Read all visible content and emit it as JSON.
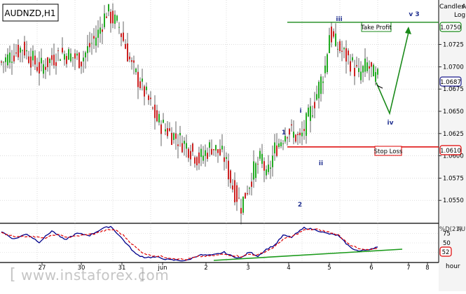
{
  "chart_data": {
    "type": "candlestick",
    "title": "AUDNZD,H1",
    "top_right": {
      "label": "Candles",
      "source": "A",
      "scale": "Log"
    },
    "osc_label": "%D(21)",
    "osc_label_suffix": "AU",
    "xlabel": "hour",
    "x_ticks": [
      "27",
      "30",
      "31",
      "jun",
      "2",
      "3",
      "4",
      "5",
      "6",
      "7",
      "8"
    ],
    "price_axis": {
      "ylim": [
        1.0525,
        1.0775
      ],
      "ticks": [
        "1.0725",
        "1.0700",
        "1.0675",
        "1.0650",
        "1.0625",
        "1.0600",
        "1.0575",
        "1.0550"
      ]
    },
    "osc_axis": {
      "ylim": [
        0,
        100
      ],
      "ticks": [
        "75",
        "50",
        "25"
      ]
    },
    "levels": {
      "take_profit": {
        "label": "Take Profit",
        "value": 1.075,
        "value_label": "1.0750",
        "color": "#1a8a1a"
      },
      "stop_loss": {
        "label": "Stop Loss",
        "value": 1.061,
        "value_label": "1.0610",
        "color": "#dd0000"
      },
      "current": {
        "value": 1.0687,
        "value_label": "1.0687",
        "color": "#1a1a8c"
      }
    },
    "osc_current": {
      "value": 52,
      "value_label": "52"
    },
    "wave_labels": [
      "1",
      "2",
      "i",
      "ii",
      "iii",
      "iv",
      "v 3"
    ],
    "wave_label_color": "#1f2f8f",
    "series": [
      {
        "name": "price",
        "anchors": [
          [
            0,
            1.0705
          ],
          [
            10,
            1.0722
          ],
          [
            18,
            1.0698
          ],
          [
            28,
            1.0716
          ],
          [
            38,
            1.0708
          ],
          [
            46,
            1.0738
          ],
          [
            50,
            1.0762
          ],
          [
            56,
            1.0745
          ],
          [
            62,
            1.07
          ],
          [
            68,
            1.0672
          ],
          [
            74,
            1.064
          ],
          [
            80,
            1.0626
          ],
          [
            88,
            1.0612
          ],
          [
            94,
            1.0596
          ],
          [
            100,
            1.0611
          ],
          [
            106,
            1.0598
          ],
          [
            110,
            1.0565
          ],
          [
            114,
            1.0544
          ],
          [
            120,
            1.0583
          ],
          [
            124,
            1.0598
          ],
          [
            126,
            1.0574
          ],
          [
            130,
            1.0607
          ],
          [
            136,
            1.063
          ],
          [
            142,
            1.0618
          ],
          [
            148,
            1.0655
          ],
          [
            154,
            1.07
          ],
          [
            156,
            1.0738
          ],
          [
            160,
            1.0722
          ],
          [
            166,
            1.0706
          ],
          [
            170,
            1.069
          ],
          [
            174,
            1.0702
          ],
          [
            178,
            1.0687
          ]
        ]
      },
      {
        "name": "%K",
        "color": "#00008b",
        "anchors": [
          [
            0,
            80
          ],
          [
            6,
            60
          ],
          [
            12,
            74
          ],
          [
            18,
            52
          ],
          [
            24,
            82
          ],
          [
            30,
            58
          ],
          [
            36,
            75
          ],
          [
            42,
            70
          ],
          [
            48,
            88
          ],
          [
            52,
            94
          ],
          [
            56,
            70
          ],
          [
            60,
            45
          ],
          [
            64,
            20
          ],
          [
            68,
            12
          ],
          [
            74,
            12
          ],
          [
            80,
            5
          ],
          [
            88,
            3
          ],
          [
            94,
            18
          ],
          [
            100,
            17
          ],
          [
            106,
            25
          ],
          [
            110,
            14
          ],
          [
            114,
            10
          ],
          [
            118,
            26
          ],
          [
            122,
            15
          ],
          [
            126,
            33
          ],
          [
            130,
            44
          ],
          [
            134,
            70
          ],
          [
            138,
            65
          ],
          [
            144,
            90
          ],
          [
            150,
            84
          ],
          [
            154,
            76
          ],
          [
            160,
            70
          ],
          [
            166,
            38
          ],
          [
            170,
            28
          ],
          [
            174,
            32
          ],
          [
            178,
            38
          ]
        ]
      },
      {
        "name": "%D",
        "color": "#dd0000",
        "anchors": [
          [
            0,
            76
          ],
          [
            8,
            66
          ],
          [
            14,
            68
          ],
          [
            20,
            62
          ],
          [
            26,
            72
          ],
          [
            32,
            65
          ],
          [
            38,
            70
          ],
          [
            44,
            74
          ],
          [
            50,
            84
          ],
          [
            54,
            85
          ],
          [
            58,
            70
          ],
          [
            62,
            48
          ],
          [
            66,
            28
          ],
          [
            70,
            18
          ],
          [
            76,
            14
          ],
          [
            82,
            9
          ],
          [
            88,
            6
          ],
          [
            94,
            14
          ],
          [
            100,
            16
          ],
          [
            106,
            20
          ],
          [
            110,
            17
          ],
          [
            114,
            14
          ],
          [
            118,
            20
          ],
          [
            122,
            18
          ],
          [
            126,
            28
          ],
          [
            130,
            40
          ],
          [
            134,
            60
          ],
          [
            138,
            66
          ],
          [
            144,
            84
          ],
          [
            150,
            86
          ],
          [
            156,
            78
          ],
          [
            160,
            72
          ],
          [
            166,
            45
          ],
          [
            170,
            34
          ],
          [
            174,
            31
          ],
          [
            178,
            34
          ]
        ]
      }
    ]
  },
  "watermark": {
    "text": "www.instaforex.com",
    "bracket_left": "[",
    "bracket_right": "]"
  }
}
